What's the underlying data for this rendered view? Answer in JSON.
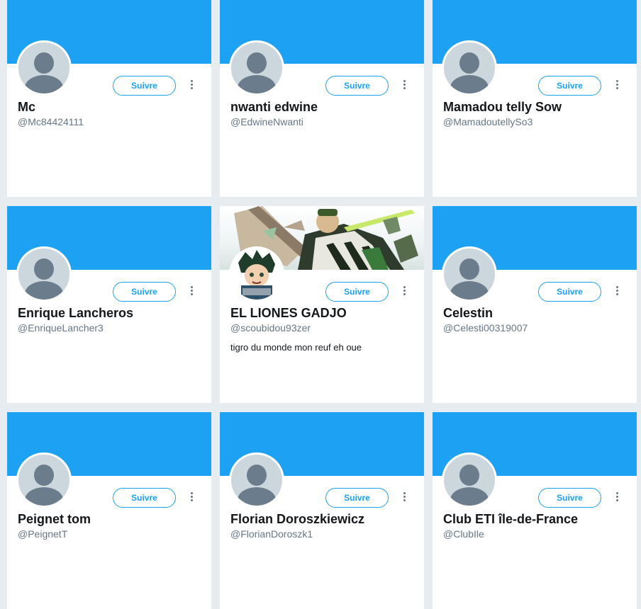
{
  "follow_label": "Suivre",
  "colors": {
    "accent": "#1da1f2",
    "background": "#e6ecf0",
    "avatar_placeholder": "#ccd6dd"
  },
  "cards": [
    {
      "name": "Mc",
      "handle": "@Mc84424111",
      "bio": ""
    },
    {
      "name": "nwanti edwine",
      "handle": "@EdwineNwanti",
      "bio": ""
    },
    {
      "name": "Mamadou telly Sow",
      "handle": "@MamadoutellySo3",
      "bio": ""
    },
    {
      "name": "Enrique Lancheros",
      "handle": "@EnriqueLancher3",
      "bio": ""
    },
    {
      "name": "EL LIONES GADJO",
      "handle": "@scoubidou93zer",
      "bio": "tigro du monde mon reuf eh oue",
      "banner": "anime-art-banner",
      "avatar": "anime-character-avatar"
    },
    {
      "name": "Celestin",
      "handle": "@Celesti00319007",
      "bio": ""
    },
    {
      "name": "Peignet tom",
      "handle": "@PeignetT",
      "bio": ""
    },
    {
      "name": "Florian Doroszkiewicz",
      "handle": "@FlorianDoroszk1",
      "bio": ""
    },
    {
      "name": "Club ETI île-de-France",
      "handle": "@ClubIle",
      "bio": ""
    }
  ]
}
